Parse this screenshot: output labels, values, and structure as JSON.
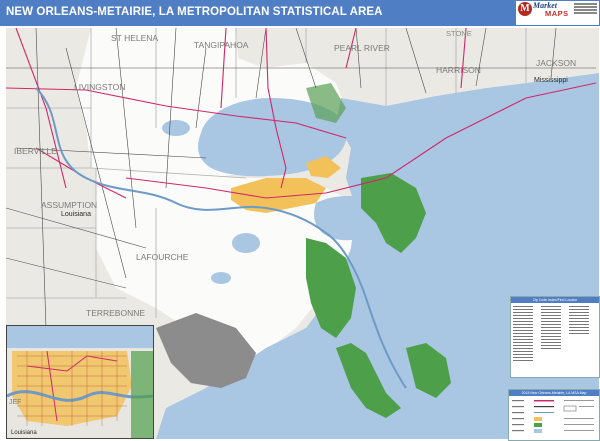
{
  "header": {
    "title": "NEW ORLEANS-METAIRIE, LA METROPOLITAN STATISTICAL AREA",
    "logo": {
      "brand_top": "Market",
      "brand_bottom": "MAPS",
      "icon": "market-maps-logo-icon",
      "accent": "#c4302b"
    }
  },
  "colors": {
    "header_bar": "#4f7ec4",
    "water": "#a9c6e2",
    "land": "#ffffff",
    "land_outside": "#e9e8e4",
    "wetlands": "#3f9b3f",
    "urban": "#f2c15a",
    "highway": "#d0286a",
    "road": "#404040"
  },
  "map": {
    "places": {
      "st_helena": "ST HELENA",
      "tangipahoa": "TANGIPAHOA",
      "pearl_river": "PEARL RIVER",
      "stone": "STONE",
      "harrison": "HARRISON",
      "jackson": "JACKSON",
      "mississippi": "Mississippi",
      "livingston": "LIVINGSTON",
      "iberville": "IBERVILLE",
      "assumption": "ASSUMPTION",
      "louisiana": "Louisiana",
      "lafourche": "LAFOURCHE",
      "terrebonne": "TERREBONNE"
    }
  },
  "legend_zip": {
    "title": "Zip Code Index/Find Locator"
  },
  "legend_map": {
    "title": "2015 New Orleans-Metairie, LA MSA Map"
  },
  "inset": {
    "places": {
      "jefferson": "JEF",
      "louisiana": "Louisiana"
    }
  }
}
